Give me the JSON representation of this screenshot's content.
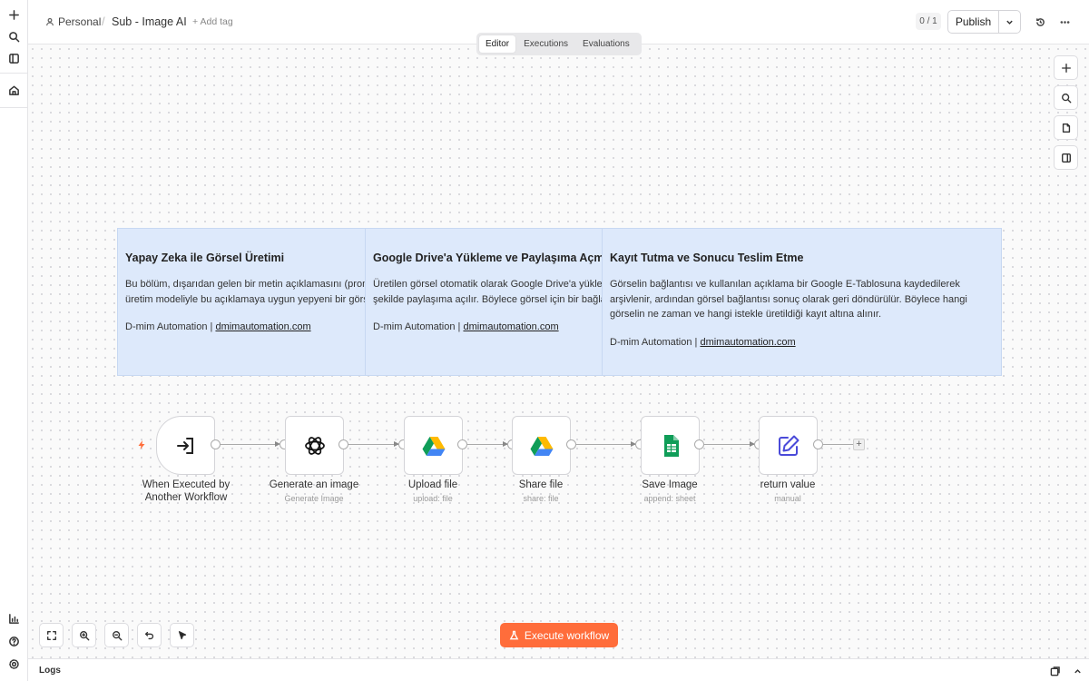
{
  "header": {
    "breadcrumb_project": "Personal",
    "breadcrumb_separator": "/",
    "workflow_name": "Sub - Image AI",
    "add_tag": "+ Add tag",
    "counter": "0 / 1",
    "publish_label": "Publish"
  },
  "tabs": [
    {
      "label": "Editor",
      "active": true
    },
    {
      "label": "Executions",
      "active": false
    },
    {
      "label": "Evaluations",
      "active": false
    }
  ],
  "notes": [
    {
      "title": "Yapay Zeka ile Görsel Üretimi",
      "lines": [
        "Bu bölüm, dışarıdan gelen bir metin açıklamasını (prompt) alarak",
        "üretim modeliyle bu açıklamaya uygun yepyeni bir görsel oluşturur."
      ],
      "sig_prefix": "D-mim Automation | ",
      "sig_link": "dmimautomation.com"
    },
    {
      "title": "Google Drive'a Yükleme ve Paylaşıma Açma",
      "lines": [
        "Üretilen görsel otomatik olarak Google Drive'a yüklenir ve herkese açık",
        "şekilde paylaşıma açılır. Böylece görsel için bir bağlantı oluşur."
      ],
      "sig_prefix": "D-mim Automation | ",
      "sig_link": "dmimautomation.com"
    },
    {
      "title": "Kayıt Tutma ve Sonucu Teslim Etme",
      "lines": [
        "Görselin bağlantısı ve kullanılan açıklama bir Google E-Tablosuna kaydedilerek",
        "arşivlenir, ardından görsel bağlantısı sonuç olarak geri döndürülür. Böylece hangi",
        "görselin ne zaman ve hangi istekle üretildiği kayıt altına alınır."
      ],
      "sig_prefix": "D-mim Automation | ",
      "sig_link": "dmimautomation.com"
    }
  ],
  "nodes": [
    {
      "label": "When Executed by Another Workflow",
      "sub": "",
      "icon": "enter-icon"
    },
    {
      "label": "Generate an image",
      "sub": "Generate Image",
      "icon": "openai-icon"
    },
    {
      "label": "Upload file",
      "sub": "upload: file",
      "icon": "google-drive-icon"
    },
    {
      "label": "Share file",
      "sub": "share: file",
      "icon": "google-drive-icon"
    },
    {
      "label": "Save Image",
      "sub": "append: sheet",
      "icon": "google-sheets-icon"
    },
    {
      "label": "return value",
      "sub": "manual",
      "icon": "edit-icon"
    }
  ],
  "execute_label": "Execute workflow",
  "logs_label": "Logs",
  "colors": {
    "accent": "#ff6d3b",
    "note_bg": "#dde9fb",
    "edit_icon": "#4a4ad9"
  }
}
